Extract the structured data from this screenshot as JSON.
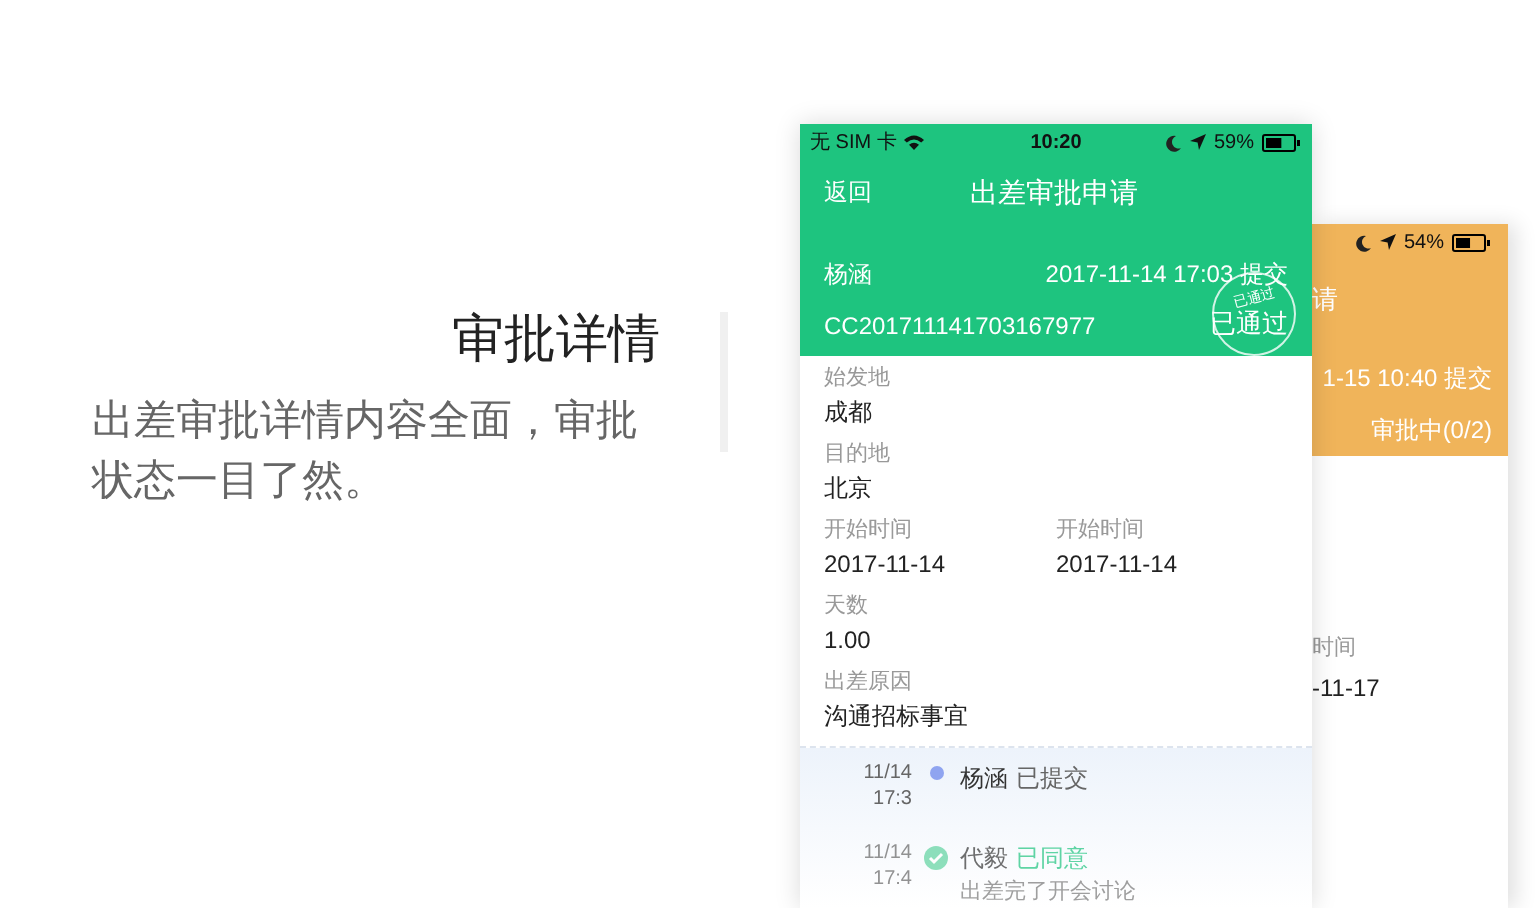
{
  "intro": {
    "title": "审批详情",
    "description": "出差审批详情内容全面，审批状态一目了然。"
  },
  "front_phone": {
    "status_bar": {
      "carrier": "无 SIM 卡",
      "time": "10:20",
      "battery": "59%"
    },
    "nav": {
      "back": "返回",
      "title": "出差审批申请"
    },
    "header": {
      "applicant": "杨涵",
      "submitted": "2017-11-14 17:03 提交",
      "code": "CC201711141703167977",
      "status": "已通过",
      "stamp": "已通过"
    },
    "rows": [
      {
        "cells": [
          {
            "label": "始发地",
            "value": "成都"
          }
        ]
      },
      {
        "cells": [
          {
            "label": "目的地",
            "value": "北京"
          }
        ]
      },
      {
        "cells": [
          {
            "label": "开始时间",
            "value": "2017-11-14"
          },
          {
            "label": "开始时间",
            "value": "2017-11-14"
          }
        ]
      },
      {
        "cells": [
          {
            "label": "天数",
            "value": "1.00"
          }
        ]
      },
      {
        "cells": [
          {
            "label": "出差原因",
            "value": "沟通招标事宜"
          }
        ]
      }
    ],
    "timeline": [
      {
        "date": "11/14",
        "time": "17:3",
        "name": "杨涵",
        "action": "已提交",
        "kind": "submitted"
      },
      {
        "date": "11/14",
        "time": "17:4",
        "name": "代毅",
        "action": "已同意",
        "kind": "approved",
        "comment": "出差完了开会讨论"
      }
    ]
  },
  "back_phone": {
    "battery": "54%",
    "title_fragment": "请",
    "submitted": "1-15 10:40 提交",
    "status": "审批中(0/2)",
    "field_label": "时间",
    "field_value": "-11-17"
  }
}
